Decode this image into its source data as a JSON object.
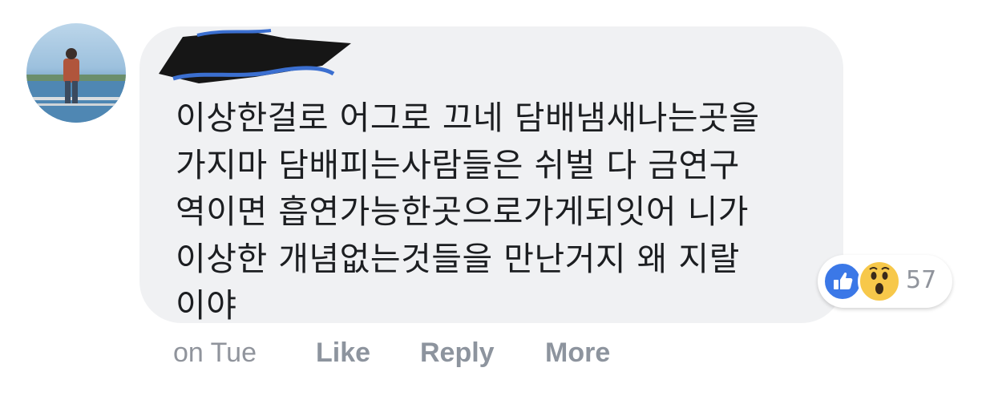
{
  "comment": {
    "author": "",
    "text": "이상한걸로 어그로 끄네 담배냄새나는곳을\n가지마 담배피는사람들은 쉬벌 다 금연구\n역이면 흡연가능한곳으로가게되잇어 니가\n이상한 개념없는것들을 만난거지 왜 지랄\n이야"
  },
  "reactions": {
    "icons": [
      "like-icon",
      "wow-icon"
    ],
    "count": "57"
  },
  "actions": {
    "timestamp": "on Tue",
    "like_label": "Like",
    "reply_label": "Reply",
    "more_label": "More"
  },
  "colors": {
    "bubble": "#f0f1f3",
    "text": "#1c1e21",
    "meta": "#90949c",
    "like_blue": "#3b78e7",
    "wow_yellow": "#f7c84a"
  }
}
